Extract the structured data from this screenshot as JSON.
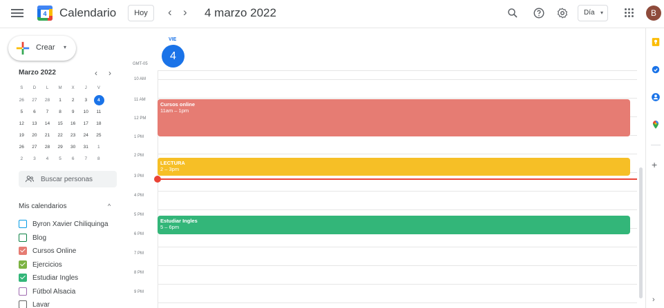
{
  "header": {
    "app_name": "Calendario",
    "logo_day": "4",
    "today_button": "Hoy",
    "prev_icon": "‹",
    "next_icon": "›",
    "current_date": "4 marzo 2022",
    "view_mode": "Día",
    "view_caret": "▾",
    "avatar_initial": "B",
    "icons": [
      "menu-icon",
      "search-icon",
      "help-icon",
      "settings-icon",
      "apps-icon"
    ]
  },
  "create": {
    "label": "Crear",
    "caret": "▾"
  },
  "mini_calendar": {
    "title": "Marzo 2022",
    "prev": "‹",
    "next": "›",
    "weekdays": [
      "S",
      "D",
      "L",
      "M",
      "X",
      "J",
      "V"
    ],
    "weeks": [
      [
        "26",
        "27",
        "28",
        "1",
        "2",
        "3",
        "4"
      ],
      [
        "5",
        "6",
        "7",
        "8",
        "9",
        "10",
        "11"
      ],
      [
        "12",
        "13",
        "14",
        "15",
        "16",
        "17",
        "18"
      ],
      [
        "19",
        "20",
        "21",
        "22",
        "23",
        "24",
        "25"
      ],
      [
        "26",
        "27",
        "28",
        "29",
        "30",
        "31",
        "1"
      ],
      [
        "2",
        "3",
        "4",
        "5",
        "6",
        "7",
        "8"
      ]
    ]
  },
  "search_people": {
    "placeholder": "Buscar personas"
  },
  "my_calendars": {
    "title": "Mis calendarios",
    "toggle": "^",
    "items": [
      {
        "name": "Byron Xavier Chiliquinga",
        "color": "#039be5",
        "checked": false
      },
      {
        "name": "Blog",
        "color": "#0b8043",
        "checked": false
      },
      {
        "name": "Cursos Online",
        "color": "#e67c73",
        "checked": true
      },
      {
        "name": "Ejercicios",
        "color": "#7cb342",
        "checked": true
      },
      {
        "name": "Estudiar Ingles",
        "color": "#33b679",
        "checked": true
      },
      {
        "name": "Fútbol Alsacia",
        "color": "#9e69af",
        "checked": false
      },
      {
        "name": "Lavar",
        "color": "#616161",
        "checked": false
      }
    ]
  },
  "day_view": {
    "weekday": "VIE",
    "day_number": "4",
    "timezone": "GMT-05",
    "hours": [
      "10 AM",
      "11 AM",
      "12 PM",
      "1 PM",
      "2 PM",
      "3 PM",
      "4 PM",
      "5 PM",
      "6 PM",
      "7 PM",
      "8 PM",
      "9 PM"
    ],
    "events": [
      {
        "title": "Cursos online",
        "time": "11am – 1pm",
        "color": "#e67c73"
      },
      {
        "title": "LECTURA",
        "time": "2 – 3pm",
        "color": "#f6bf26"
      },
      {
        "title": "Estudiar Ingles",
        "time": "5 – 6pm",
        "color": "#33b679"
      }
    ]
  },
  "side_panel": {
    "add": "+",
    "expand": "›",
    "icons": [
      "keep-icon",
      "tasks-icon",
      "contacts-icon",
      "maps-icon"
    ]
  }
}
